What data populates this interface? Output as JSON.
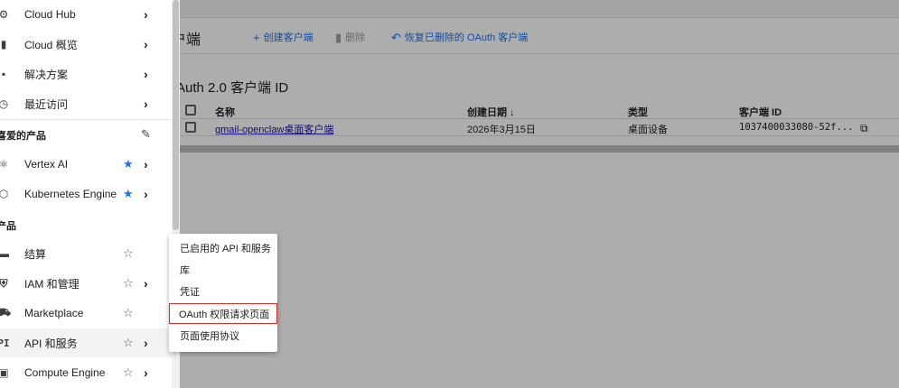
{
  "toolbar": {
    "title": "户端",
    "create_label": "创建客户端",
    "delete_label": "删除",
    "restore_label": "恢复已删除的 OAuth 客户端"
  },
  "section": {
    "title": "Auth 2.0 客户端 ID"
  },
  "table": {
    "headers": {
      "name": "名称",
      "created": "创建日期 ↓",
      "type": "类型",
      "client_id": "客户端 ID"
    },
    "rows": [
      {
        "name": "gmail-openclaw桌面客户端",
        "created": "2026年3月15日",
        "type": "桌面设备",
        "client_id": "1037400033080-52f..."
      }
    ]
  },
  "sidebar": {
    "items_top": [
      {
        "label": "Cloud Hub",
        "icon": "⚙"
      },
      {
        "label": "Cloud 概览",
        "icon": "▮"
      },
      {
        "label": "解决方案",
        "icon": "▪"
      },
      {
        "label": "最近访问",
        "icon": "◷"
      }
    ],
    "favorites_label": "喜爱的产品",
    "favorites": [
      {
        "label": "Vertex AI",
        "icon": "⚛"
      },
      {
        "label": "Kubernetes Engine",
        "icon": "⬡"
      }
    ],
    "products_label": "产品",
    "products": [
      {
        "label": "结算",
        "icon": "▬"
      },
      {
        "label": "IAM 和管理",
        "icon": "⛨"
      },
      {
        "label": "Marketplace",
        "icon": "⛟"
      },
      {
        "label": "API 和服务",
        "icon": "PI"
      },
      {
        "label": "Compute Engine",
        "icon": "▣"
      }
    ]
  },
  "submenu": {
    "items": [
      {
        "label": "已启用的 API 和服务"
      },
      {
        "label": "库"
      },
      {
        "label": "凭证"
      },
      {
        "label": "OAuth 权限请求页面"
      },
      {
        "label": "页面使用协议"
      }
    ]
  },
  "colors": {
    "accent": "#1a73e8",
    "highlight_border": "#d93025"
  }
}
